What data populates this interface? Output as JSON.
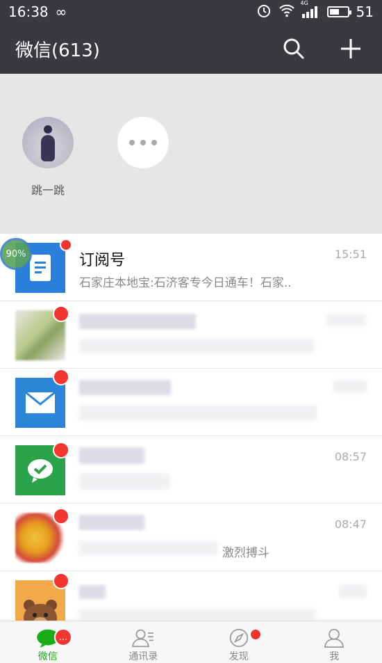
{
  "status_bar": {
    "time": "16:38",
    "network": "4G",
    "battery": "51"
  },
  "header": {
    "title": "微信(613)",
    "icons": [
      "search-icon",
      "plus-icon"
    ]
  },
  "mini_programs": [
    {
      "label": "跳一跳",
      "icon": "jump-game-icon"
    },
    {
      "label": "",
      "icon": "more-icon"
    }
  ],
  "chats": [
    {
      "name": "订阅号",
      "preview": "石家庄本地宝:石济客专今日通车！石家..",
      "time": "15:51",
      "avatar": "subscription-icon",
      "badge": "red-dot",
      "progress": "90%"
    },
    {
      "name": "",
      "preview": "",
      "time": "",
      "avatar": "blurred-avatar",
      "badge": "red-dot"
    },
    {
      "name": "",
      "preview": "",
      "time": "",
      "avatar": "mail-icon",
      "badge": "red-dot"
    },
    {
      "name": "",
      "preview": "",
      "time": "08:57",
      "avatar": "wechat-green-icon",
      "badge": "red-dot"
    },
    {
      "name": "",
      "preview": "激烈搏斗",
      "time": "08:47",
      "avatar": "blurred-avatar",
      "badge": "red-dot"
    },
    {
      "name": "",
      "preview": "",
      "time": "",
      "avatar": "bear-avatar",
      "badge": "red-dot"
    }
  ],
  "tabs": [
    {
      "label": "微信",
      "icon": "chat-icon",
      "active": true,
      "badge": "..."
    },
    {
      "label": "通讯录",
      "icon": "contacts-icon",
      "active": false
    },
    {
      "label": "发现",
      "icon": "compass-icon",
      "active": false,
      "badge": "red-dot"
    },
    {
      "label": "我",
      "icon": "me-icon",
      "active": false
    }
  ],
  "colors": {
    "header": "#393a3f",
    "accent": "#1aad19",
    "badge": "#f43530"
  }
}
